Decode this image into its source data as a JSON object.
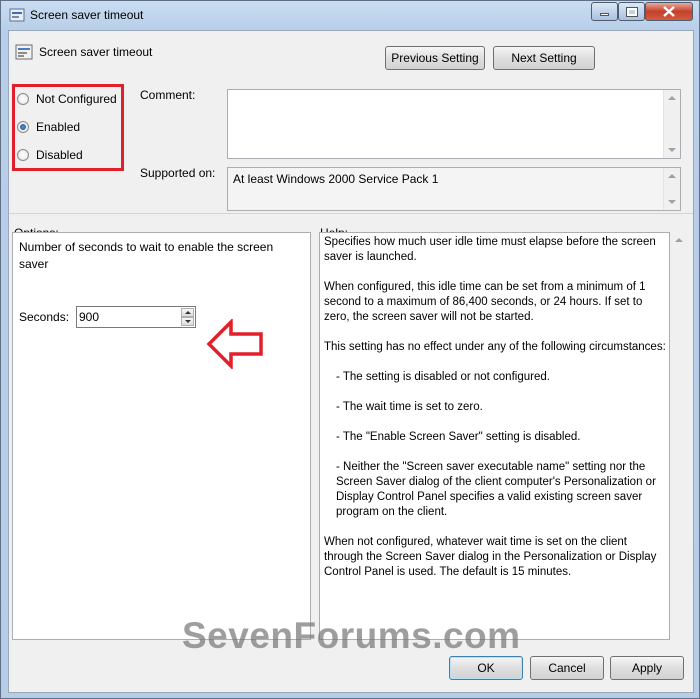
{
  "window": {
    "title": "Screen saver timeout",
    "title_icon": "policy-icon",
    "controls": [
      "minimize-icon",
      "maximize-icon",
      "close-icon"
    ]
  },
  "header": {
    "title": "Screen saver timeout",
    "icon": "policy-setting-icon",
    "previous_button": "Previous Setting",
    "next_button": "Next Setting"
  },
  "state": {
    "options": [
      {
        "label": "Not Configured",
        "checked": false
      },
      {
        "label": "Enabled",
        "checked": true
      },
      {
        "label": "Disabled",
        "checked": false
      }
    ]
  },
  "comment": {
    "label": "Comment:",
    "value": ""
  },
  "supported": {
    "label": "Supported on:",
    "value": "At least Windows 2000 Service Pack 1"
  },
  "options_section": {
    "label": "Options:",
    "description": "Number of seconds to wait to enable the screen saver",
    "seconds_label": "Seconds:",
    "seconds_value": "900"
  },
  "help_section": {
    "label": "Help:",
    "paragraphs": [
      "Specifies how much user idle time must elapse before the screen saver is launched.",
      "When configured, this idle time can be set from a minimum of 1 second to a maximum of 86,400 seconds, or 24 hours. If set to zero, the screen saver will not be started.",
      "This setting has no effect under any of the following circumstances:",
      "- The setting is disabled or not configured.",
      "- The wait time is set to zero.",
      "- The \"Enable Screen Saver\" setting is disabled.",
      "- Neither the \"Screen saver executable name\" setting nor the Screen Saver dialog of the client computer's Personalization or Display Control Panel specifies a valid existing screen saver program on the client.",
      "When not configured, whatever wait time is set on the client through the Screen Saver dialog in the Personalization or Display Control Panel is used. The default is 15 minutes."
    ]
  },
  "footer": {
    "ok": "OK",
    "cancel": "Cancel",
    "apply": "Apply"
  },
  "watermark": "SevenForums.com",
  "colors": {
    "annotation": "#e2202b",
    "titlebar": "#b8cfe9",
    "client": "#f0f0f0"
  }
}
